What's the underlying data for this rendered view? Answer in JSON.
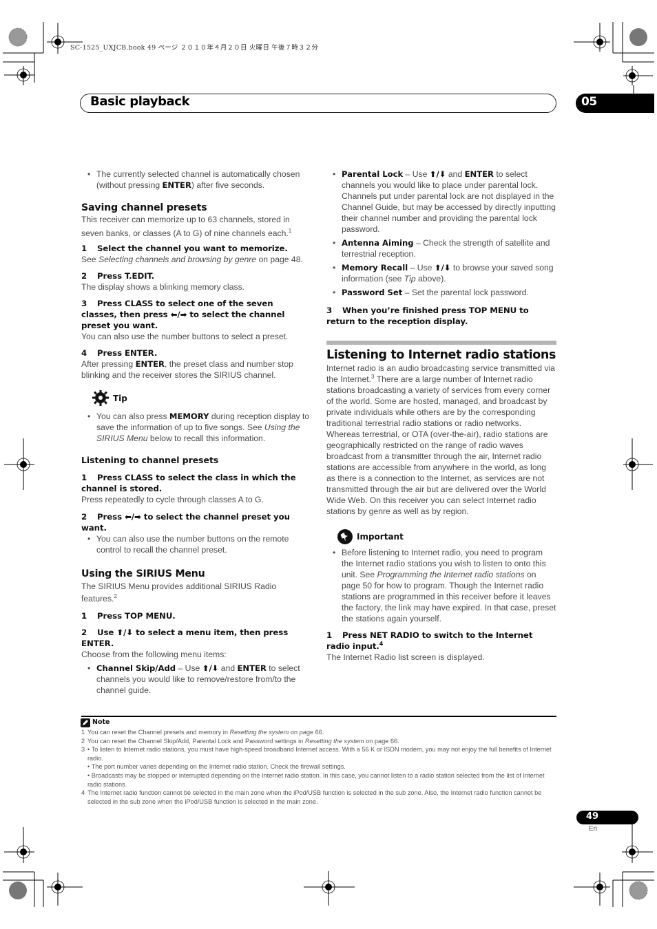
{
  "print_meta": "SC-1525_UXJCB.book  49 ページ  ２０１０年４月２０日  火曜日  午後７時３２分",
  "header": {
    "section_title": "Basic playback",
    "chapter_number": "05"
  },
  "left_column": {
    "intro_bullet": {
      "pre": "The currently selected channel is automatically chosen (without pressing ",
      "bold": "ENTER",
      "post": ") after five seconds."
    },
    "saving": {
      "heading": "Saving channel presets",
      "body": "This receiver can memorize up to 63 channels, stored in seven banks, or classes (A to G) of nine channels each.",
      "body_ref": "1",
      "steps": [
        {
          "num": "1",
          "title": "Select the channel you want to memorize.",
          "body_pre": "See ",
          "body_italic": "Selecting channels and browsing by genre",
          "body_post": " on page 48."
        },
        {
          "num": "2",
          "title": "Press T.EDIT.",
          "body": "The display shows a blinking memory class."
        },
        {
          "num": "3",
          "title_pre": "Press CLASS to select one of the seven classes, then press ",
          "arrows": "⬅/➡",
          "title_post": " to select the channel preset you want.",
          "body": "You can also use the number buttons to select a preset."
        },
        {
          "num": "4",
          "title": "Press ENTER.",
          "body_pre": "After pressing ",
          "body_bold": "ENTER",
          "body_post": ", the preset class and number stop blinking and the receiver stores the SIRIUS channel."
        }
      ]
    },
    "tip": {
      "label": "Tip",
      "icon": "lightbulb-icon",
      "pre": "You can also press ",
      "bold": "MEMORY",
      "mid": " during reception display to save the information of up to five songs. See ",
      "italic": "Using the SIRIUS Menu",
      "post": " below to recall this information."
    },
    "listening": {
      "heading": "Listening to channel presets",
      "steps": [
        {
          "num": "1",
          "title": "Press CLASS to select the class in which the channel is stored.",
          "body": "Press repeatedly to cycle through classes A to G."
        },
        {
          "num": "2",
          "title_pre": "Press ",
          "arrows": "⬅/➡",
          "title_post": " to select the channel preset you want.",
          "bullet": "You can also use the number buttons on the remote control to recall the channel preset."
        }
      ]
    },
    "sirius": {
      "heading": "Using the SIRIUS Menu",
      "body": "The SIRIUS Menu provides additional SIRIUS Radio features.",
      "body_ref": "2",
      "steps": [
        {
          "num": "1",
          "title": "Press TOP MENU."
        },
        {
          "num": "2",
          "title_pre": "Use ",
          "arrows": "⬆/⬇",
          "title_post": " to select a menu item, then press ENTER.",
          "body": "Choose from the following menu items:"
        }
      ],
      "menu_items": [
        {
          "name": "Channel Skip/Add",
          "pre": " – Use ",
          "arrows": "⬆/⬇",
          "mid": " and ",
          "bold2": "ENTER",
          "post": " to select channels you would like to remove/restore from/to the channel guide."
        }
      ]
    }
  },
  "right_column": {
    "menu_items": [
      {
        "name": "Parental Lock",
        "pre": " – Use ",
        "arrows": "⬆/⬇",
        "mid": " and ",
        "bold2": "ENTER",
        "post": " to select channels you would like to place under parental lock. Channels put under parental lock are not displayed in the Channel Guide, but may be accessed by directly inputting their channel number and providing the parental lock password."
      },
      {
        "name": "Antenna Aiming",
        "post": " – Check the strength of satellite and terrestrial reception."
      },
      {
        "name": "Memory Recall",
        "pre": " – Use ",
        "arrows": "⬆/⬇",
        "post": " to browse your saved song information (see ",
        "italic": "Tip",
        "post2": " above)."
      },
      {
        "name": "Password Set",
        "post": " – Set the parental lock password."
      }
    ],
    "step3": {
      "num": "3",
      "title": "When you’re finished press TOP MENU to return to the reception display."
    },
    "internet": {
      "heading": "Listening to Internet radio stations",
      "body_1": "Internet radio is an audio broadcasting service transmitted via the Internet.",
      "body_ref": "3",
      "body_2": " There are a large number of Internet radio stations broadcasting a variety of services from every corner of the world. Some are hosted, managed, and broadcast by private individuals while others are by the corresponding traditional terrestrial radio stations or radio networks. Whereas terrestrial, or OTA (over-the-air), radio stations are geographically restricted on the range of radio waves broadcast from a transmitter through the air, Internet radio stations are accessible from anywhere in the world, as long as there is a connection to the Internet, as services are not transmitted through the air but are delivered over the World Wide Web. On this receiver you can select Internet radio stations by genre as well as by region."
    },
    "important": {
      "label": "Important",
      "icon": "pushpin-icon",
      "pre": "Before listening to Internet radio, you need to program the Internet radio stations you wish to listen to onto this unit. See ",
      "italic": "Programming the Internet radio stations",
      "post": " on page 50 for how to program. Though the Internet radio stations are programmed in this receiver before it leaves the factory, the link may have expired. In that case, preset the stations again yourself."
    },
    "step1": {
      "num": "1",
      "title": "Press NET RADIO to switch to the Internet radio input.",
      "ref": "4",
      "body": "The Internet Radio list screen is displayed."
    }
  },
  "notes": {
    "label": "Note",
    "icon": "pencil-note-icon",
    "items": [
      {
        "num": "1",
        "pre": "You can reset the Channel presets and memory in ",
        "italic": "Resetting the system",
        "post": " on page 66."
      },
      {
        "num": "2",
        "pre": "You can reset the Channel Skip/Add, Parental Lock and Password settings in ",
        "italic": "Resetting the system",
        "post": " on page 66."
      },
      {
        "num": "3",
        "lines": [
          "• To listen to Internet radio stations, you must have high-speed broadband Internet access. With a 56 K or ISDN modem, you may not enjoy the full benefits of Internet radio.",
          "• The port number varies depending on the Internet radio station. Check the firewall settings.",
          "• Broadcasts may be stopped or interrupted depending on the Internet radio station. In this case, you cannot listen to a radio station selected from the list of Internet radio stations."
        ]
      },
      {
        "num": "4",
        "text": "The Internet radio function cannot be selected in the main zone when the iPod/USB function is selected in the sub zone. Also, the Internet radio function cannot be selected in the sub zone when the iPod/USB function is selected in the main zone."
      }
    ]
  },
  "footer": {
    "page_number": "49",
    "language": "En"
  }
}
